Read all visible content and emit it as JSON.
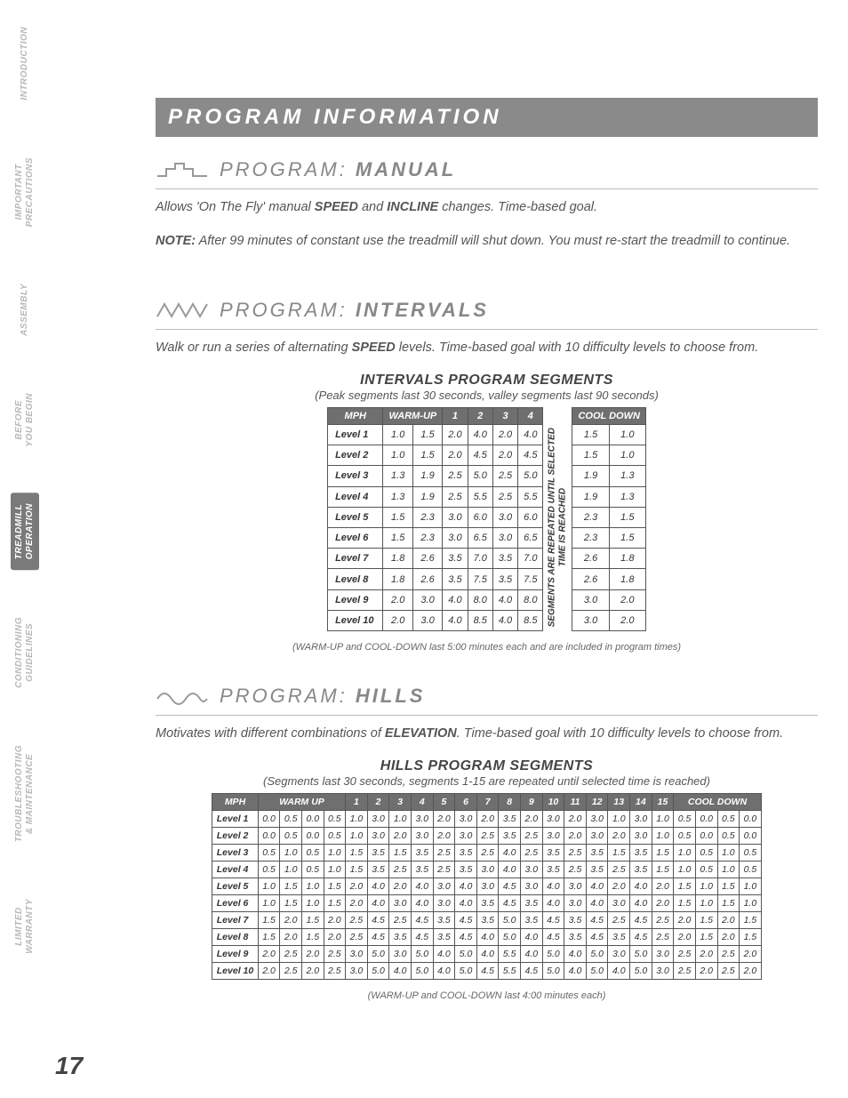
{
  "page_number": "17",
  "sidebar": [
    "INTRODUCTION",
    "IMPORTANT\nPRECAUTIONS",
    "ASSEMBLY",
    "BEFORE\nYOU BEGIN",
    "TREADMILL\nOPERATION",
    "CONDITIONING\nGUIDELINES",
    "TROUBLESHOOTING\n& MAINTENANCE",
    "LIMITED\nWARRANTY"
  ],
  "sidebar_active_index": 4,
  "header": "PROGRAM INFORMATION",
  "prog_prefix": "PROGRAM: ",
  "manual": {
    "name": "MANUAL",
    "desc_pre": "Allows 'On The Fly' manual ",
    "desc_speed": "SPEED",
    "desc_mid": " and ",
    "desc_incline": "INCLINE",
    "desc_post": " changes. Time-based goal.",
    "note_label": "NOTE:",
    "note_text": " After 99 minutes of constant use the treadmill will shut down. You must re-start the treadmill to continue."
  },
  "intervals": {
    "name": "INTERVALS",
    "desc_pre": "Walk or run a series of alternating ",
    "desc_speed": "SPEED",
    "desc_post": " levels. Time-based goal with 10 difficulty levels to choose from.",
    "table_title": "INTERVALS PROGRAM SEGMENTS",
    "table_sub": "(Peak segments last 30 seconds, valley segments last 90 seconds)",
    "table_note": "(WARM-UP and COOL-DOWN last 5:00 minutes each and are included in program times)",
    "col_mph": "MPH",
    "col_warmup": "WARM-UP",
    "col_cooldown": "COOL DOWN",
    "segcols": [
      "1",
      "2",
      "3",
      "4"
    ],
    "repeat_text": "SEGMENTS ARE REPEATED UNTIL SELECTED\nTIME IS REACHED",
    "rows": [
      {
        "label": "Level 1",
        "wu": [
          "1.0",
          "1.5"
        ],
        "seg": [
          "2.0",
          "4.0",
          "2.0",
          "4.0"
        ],
        "cd": [
          "1.5",
          "1.0"
        ]
      },
      {
        "label": "Level 2",
        "wu": [
          "1.0",
          "1.5"
        ],
        "seg": [
          "2.0",
          "4.5",
          "2.0",
          "4.5"
        ],
        "cd": [
          "1.5",
          "1.0"
        ]
      },
      {
        "label": "Level 3",
        "wu": [
          "1.3",
          "1.9"
        ],
        "seg": [
          "2.5",
          "5.0",
          "2.5",
          "5.0"
        ],
        "cd": [
          "1.9",
          "1.3"
        ]
      },
      {
        "label": "Level 4",
        "wu": [
          "1.3",
          "1.9"
        ],
        "seg": [
          "2.5",
          "5.5",
          "2.5",
          "5.5"
        ],
        "cd": [
          "1.9",
          "1.3"
        ]
      },
      {
        "label": "Level 5",
        "wu": [
          "1.5",
          "2.3"
        ],
        "seg": [
          "3.0",
          "6.0",
          "3.0",
          "6.0"
        ],
        "cd": [
          "2.3",
          "1.5"
        ]
      },
      {
        "label": "Level 6",
        "wu": [
          "1.5",
          "2.3"
        ],
        "seg": [
          "3.0",
          "6.5",
          "3.0",
          "6.5"
        ],
        "cd": [
          "2.3",
          "1.5"
        ]
      },
      {
        "label": "Level 7",
        "wu": [
          "1.8",
          "2.6"
        ],
        "seg": [
          "3.5",
          "7.0",
          "3.5",
          "7.0"
        ],
        "cd": [
          "2.6",
          "1.8"
        ]
      },
      {
        "label": "Level 8",
        "wu": [
          "1.8",
          "2.6"
        ],
        "seg": [
          "3.5",
          "7.5",
          "3.5",
          "7.5"
        ],
        "cd": [
          "2.6",
          "1.8"
        ]
      },
      {
        "label": "Level 9",
        "wu": [
          "2.0",
          "3.0"
        ],
        "seg": [
          "4.0",
          "8.0",
          "4.0",
          "8.0"
        ],
        "cd": [
          "3.0",
          "2.0"
        ]
      },
      {
        "label": "Level 10",
        "wu": [
          "2.0",
          "3.0"
        ],
        "seg": [
          "4.0",
          "8.5",
          "4.0",
          "8.5"
        ],
        "cd": [
          "3.0",
          "2.0"
        ]
      }
    ]
  },
  "hills": {
    "name": "HILLS",
    "desc_pre": "Motivates with different combinations of ",
    "desc_elev": "ELEVATION",
    "desc_post": ". Time-based goal with 10 difficulty levels to choose from.",
    "table_title": "HILLS PROGRAM SEGMENTS",
    "table_sub": "(Segments last 30 seconds, segments 1-15 are repeated until selected time is reached)",
    "table_note": "(WARM-UP and COOL-DOWN last 4:00 minutes each)",
    "col_mph": "MPH",
    "col_warmup": "WARM UP",
    "col_cooldown": "COOL DOWN",
    "segcols": [
      "1",
      "2",
      "3",
      "4",
      "5",
      "6",
      "7",
      "8",
      "9",
      "10",
      "11",
      "12",
      "13",
      "14",
      "15"
    ],
    "rows": [
      {
        "label": "Level 1",
        "wu": [
          "0.0",
          "0.5",
          "0.0",
          "0.5"
        ],
        "seg": [
          "1.0",
          "3.0",
          "1.0",
          "3.0",
          "2.0",
          "3.0",
          "2.0",
          "3.5",
          "2.0",
          "3.0",
          "2.0",
          "3.0",
          "1.0",
          "3.0",
          "1.0"
        ],
        "cd": [
          "0.5",
          "0.0",
          "0.5",
          "0.0"
        ]
      },
      {
        "label": "Level 2",
        "wu": [
          "0.0",
          "0.5",
          "0.0",
          "0.5"
        ],
        "seg": [
          "1.0",
          "3.0",
          "2.0",
          "3.0",
          "2.0",
          "3.0",
          "2.5",
          "3.5",
          "2.5",
          "3.0",
          "2.0",
          "3.0",
          "2.0",
          "3.0",
          "1.0"
        ],
        "cd": [
          "0.5",
          "0.0",
          "0.5",
          "0.0"
        ]
      },
      {
        "label": "Level 3",
        "wu": [
          "0.5",
          "1.0",
          "0.5",
          "1.0"
        ],
        "seg": [
          "1.5",
          "3.5",
          "1.5",
          "3.5",
          "2.5",
          "3.5",
          "2.5",
          "4.0",
          "2.5",
          "3.5",
          "2.5",
          "3.5",
          "1.5",
          "3.5",
          "1.5"
        ],
        "cd": [
          "1.0",
          "0.5",
          "1.0",
          "0.5"
        ]
      },
      {
        "label": "Level 4",
        "wu": [
          "0.5",
          "1.0",
          "0.5",
          "1.0"
        ],
        "seg": [
          "1.5",
          "3.5",
          "2.5",
          "3.5",
          "2.5",
          "3.5",
          "3.0",
          "4.0",
          "3.0",
          "3.5",
          "2.5",
          "3.5",
          "2.5",
          "3.5",
          "1.5"
        ],
        "cd": [
          "1.0",
          "0.5",
          "1.0",
          "0.5"
        ]
      },
      {
        "label": "Level 5",
        "wu": [
          "1.0",
          "1.5",
          "1.0",
          "1.5"
        ],
        "seg": [
          "2.0",
          "4.0",
          "2.0",
          "4.0",
          "3.0",
          "4.0",
          "3.0",
          "4.5",
          "3.0",
          "4.0",
          "3.0",
          "4.0",
          "2.0",
          "4.0",
          "2.0"
        ],
        "cd": [
          "1.5",
          "1.0",
          "1.5",
          "1.0"
        ]
      },
      {
        "label": "Level 6",
        "wu": [
          "1.0",
          "1.5",
          "1.0",
          "1.5"
        ],
        "seg": [
          "2.0",
          "4.0",
          "3.0",
          "4.0",
          "3.0",
          "4.0",
          "3.5",
          "4.5",
          "3.5",
          "4.0",
          "3.0",
          "4.0",
          "3.0",
          "4.0",
          "2.0"
        ],
        "cd": [
          "1.5",
          "1.0",
          "1.5",
          "1.0"
        ]
      },
      {
        "label": "Level 7",
        "wu": [
          "1.5",
          "2.0",
          "1.5",
          "2.0"
        ],
        "seg": [
          "2.5",
          "4.5",
          "2.5",
          "4.5",
          "3.5",
          "4.5",
          "3.5",
          "5.0",
          "3.5",
          "4.5",
          "3.5",
          "4.5",
          "2.5",
          "4.5",
          "2.5"
        ],
        "cd": [
          "2.0",
          "1.5",
          "2.0",
          "1.5"
        ]
      },
      {
        "label": "Level 8",
        "wu": [
          "1.5",
          "2.0",
          "1.5",
          "2.0"
        ],
        "seg": [
          "2.5",
          "4.5",
          "3.5",
          "4.5",
          "3.5",
          "4.5",
          "4.0",
          "5.0",
          "4.0",
          "4.5",
          "3.5",
          "4.5",
          "3.5",
          "4.5",
          "2.5"
        ],
        "cd": [
          "2.0",
          "1.5",
          "2.0",
          "1.5"
        ]
      },
      {
        "label": "Level 9",
        "wu": [
          "2.0",
          "2.5",
          "2.0",
          "2.5"
        ],
        "seg": [
          "3.0",
          "5.0",
          "3.0",
          "5.0",
          "4.0",
          "5.0",
          "4.0",
          "5.5",
          "4.0",
          "5.0",
          "4.0",
          "5.0",
          "3.0",
          "5.0",
          "3.0"
        ],
        "cd": [
          "2.5",
          "2.0",
          "2.5",
          "2.0"
        ]
      },
      {
        "label": "Level 10",
        "wu": [
          "2.0",
          "2.5",
          "2.0",
          "2.5"
        ],
        "seg": [
          "3.0",
          "5.0",
          "4.0",
          "5.0",
          "4.0",
          "5.0",
          "4.5",
          "5.5",
          "4.5",
          "5.0",
          "4.0",
          "5.0",
          "4.0",
          "5.0",
          "3.0"
        ],
        "cd": [
          "2.5",
          "2.0",
          "2.5",
          "2.0"
        ]
      }
    ]
  },
  "chart_data": [
    {
      "type": "table",
      "title": "INTERVALS PROGRAM SEGMENTS",
      "columns": [
        "Level",
        "Warm-Up 1",
        "Warm-Up 2",
        "Seg 1",
        "Seg 2",
        "Seg 3",
        "Seg 4",
        "Cool Down 1",
        "Cool Down 2"
      ],
      "rows": [
        [
          "Level 1",
          1.0,
          1.5,
          2.0,
          4.0,
          2.0,
          4.0,
          1.5,
          1.0
        ],
        [
          "Level 2",
          1.0,
          1.5,
          2.0,
          4.5,
          2.0,
          4.5,
          1.5,
          1.0
        ],
        [
          "Level 3",
          1.3,
          1.9,
          2.5,
          5.0,
          2.5,
          5.0,
          1.9,
          1.3
        ],
        [
          "Level 4",
          1.3,
          1.9,
          2.5,
          5.5,
          2.5,
          5.5,
          1.9,
          1.3
        ],
        [
          "Level 5",
          1.5,
          2.3,
          3.0,
          6.0,
          3.0,
          6.0,
          2.3,
          1.5
        ],
        [
          "Level 6",
          1.5,
          2.3,
          3.0,
          6.5,
          3.0,
          6.5,
          2.3,
          1.5
        ],
        [
          "Level 7",
          1.8,
          2.6,
          3.5,
          7.0,
          3.5,
          7.0,
          2.6,
          1.8
        ],
        [
          "Level 8",
          1.8,
          2.6,
          3.5,
          7.5,
          3.5,
          7.5,
          2.6,
          1.8
        ],
        [
          "Level 9",
          2.0,
          3.0,
          4.0,
          8.0,
          4.0,
          8.0,
          3.0,
          2.0
        ],
        [
          "Level 10",
          2.0,
          3.0,
          4.0,
          8.5,
          4.0,
          8.5,
          3.0,
          2.0
        ]
      ]
    },
    {
      "type": "table",
      "title": "HILLS PROGRAM SEGMENTS",
      "columns": [
        "Level",
        "WU1",
        "WU2",
        "WU3",
        "WU4",
        "1",
        "2",
        "3",
        "4",
        "5",
        "6",
        "7",
        "8",
        "9",
        "10",
        "11",
        "12",
        "13",
        "14",
        "15",
        "CD1",
        "CD2",
        "CD3",
        "CD4"
      ],
      "rows": [
        [
          "Level 1",
          0.0,
          0.5,
          0.0,
          0.5,
          1.0,
          3.0,
          1.0,
          3.0,
          2.0,
          3.0,
          2.0,
          3.5,
          2.0,
          3.0,
          2.0,
          3.0,
          1.0,
          3.0,
          1.0,
          0.5,
          0.0,
          0.5,
          0.0
        ],
        [
          "Level 2",
          0.0,
          0.5,
          0.0,
          0.5,
          1.0,
          3.0,
          2.0,
          3.0,
          2.0,
          3.0,
          2.5,
          3.5,
          2.5,
          3.0,
          2.0,
          3.0,
          2.0,
          3.0,
          1.0,
          0.5,
          0.0,
          0.5,
          0.0
        ],
        [
          "Level 3",
          0.5,
          1.0,
          0.5,
          1.0,
          1.5,
          3.5,
          1.5,
          3.5,
          2.5,
          3.5,
          2.5,
          4.0,
          2.5,
          3.5,
          2.5,
          3.5,
          1.5,
          3.5,
          1.5,
          1.0,
          0.5,
          1.0,
          0.5
        ],
        [
          "Level 4",
          0.5,
          1.0,
          0.5,
          1.0,
          1.5,
          3.5,
          2.5,
          3.5,
          2.5,
          3.5,
          3.0,
          4.0,
          3.0,
          3.5,
          2.5,
          3.5,
          2.5,
          3.5,
          1.5,
          1.0,
          0.5,
          1.0,
          0.5
        ],
        [
          "Level 5",
          1.0,
          1.5,
          1.0,
          1.5,
          2.0,
          4.0,
          2.0,
          4.0,
          3.0,
          4.0,
          3.0,
          4.5,
          3.0,
          4.0,
          3.0,
          4.0,
          2.0,
          4.0,
          2.0,
          1.5,
          1.0,
          1.5,
          1.0
        ],
        [
          "Level 6",
          1.0,
          1.5,
          1.0,
          1.5,
          2.0,
          4.0,
          3.0,
          4.0,
          3.0,
          4.0,
          3.5,
          4.5,
          3.5,
          4.0,
          3.0,
          4.0,
          3.0,
          4.0,
          2.0,
          1.5,
          1.0,
          1.5,
          1.0
        ],
        [
          "Level 7",
          1.5,
          2.0,
          1.5,
          2.0,
          2.5,
          4.5,
          2.5,
          4.5,
          3.5,
          4.5,
          3.5,
          5.0,
          3.5,
          4.5,
          3.5,
          4.5,
          2.5,
          4.5,
          2.5,
          2.0,
          1.5,
          2.0,
          1.5
        ],
        [
          "Level 8",
          1.5,
          2.0,
          1.5,
          2.0,
          2.5,
          4.5,
          3.5,
          4.5,
          3.5,
          4.5,
          4.0,
          5.0,
          4.0,
          4.5,
          3.5,
          4.5,
          3.5,
          4.5,
          2.5,
          2.0,
          1.5,
          2.0,
          1.5
        ],
        [
          "Level 9",
          2.0,
          2.5,
          2.0,
          2.5,
          3.0,
          5.0,
          3.0,
          5.0,
          4.0,
          5.0,
          4.0,
          5.5,
          4.0,
          5.0,
          4.0,
          5.0,
          3.0,
          5.0,
          3.0,
          2.5,
          2.0,
          2.5,
          2.0
        ],
        [
          "Level 10",
          2.0,
          2.5,
          2.0,
          2.5,
          3.0,
          5.0,
          4.0,
          5.0,
          4.0,
          5.0,
          4.5,
          5.5,
          4.5,
          5.0,
          4.0,
          5.0,
          4.0,
          5.0,
          3.0,
          2.5,
          2.0,
          2.5,
          2.0
        ]
      ]
    }
  ]
}
